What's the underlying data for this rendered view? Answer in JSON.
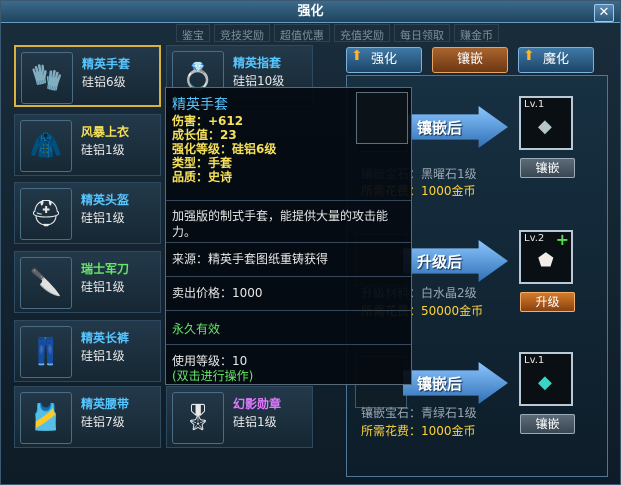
{
  "window": {
    "title": "强化",
    "close": "✕"
  },
  "topnav": [
    "鉴宝",
    "竞技奖励",
    "超值优惠",
    "充值奖励",
    "每日领取",
    "赚金币"
  ],
  "items": [
    {
      "name": "精英手套",
      "sub": "硅铝6级",
      "icon": "🧤",
      "color": "blue",
      "selected": true
    },
    {
      "name": "精英指套",
      "sub": "硅铝10级",
      "icon": "💍",
      "color": "blue",
      "selected": false
    },
    {
      "name": "风暴上衣",
      "sub": "硅铝1级",
      "icon": "🧥",
      "color": "yellow",
      "selected": false
    },
    {
      "name": "精英头盔",
      "sub": "硅铝1级",
      "icon": "⛑",
      "color": "blue",
      "selected": false
    },
    {
      "name": "瑞士军刀",
      "sub": "硅铝1级",
      "icon": "🔪",
      "color": "green",
      "selected": false
    },
    {
      "name": "精英长裤",
      "sub": "硅铝1级",
      "icon": "👖",
      "color": "blue",
      "selected": false
    },
    {
      "name": "精英腰带",
      "sub": "硅铝7级",
      "icon": "🎽",
      "color": "blue",
      "selected": false
    },
    {
      "name": "幻影勋章",
      "sub": "硅铝1级",
      "icon": "🎖",
      "color": "purple",
      "selected": false
    }
  ],
  "tabs": [
    {
      "label": "强化",
      "active": false,
      "arrow": "⬆"
    },
    {
      "label": "镶嵌",
      "active": true,
      "arrow": ""
    },
    {
      "label": "魔化",
      "active": false,
      "arrow": "⬆"
    }
  ],
  "panel": {
    "rows": [
      {
        "arrow_label": "镶嵌后",
        "lv": "Lv.1",
        "gem_icon": "◆",
        "gem_color": "#b8c4cc",
        "button": "镶嵌",
        "button_style": "gray",
        "line1": "镶嵌宝石：黑曜石1级",
        "line2": "所需花费：1000金币",
        "plus": ""
      },
      {
        "arrow_label": "升级后",
        "lv": "Lv.2",
        "gem_icon": "⬟",
        "gem_color": "#f0eee6",
        "button": "升级",
        "button_style": "orange",
        "line1": "升级材料：白水晶2级",
        "line2": "所需花费：50000金币",
        "plus": "+"
      },
      {
        "arrow_label": "镶嵌后",
        "lv": "Lv.1",
        "gem_icon": "◆",
        "gem_color": "#3ad4c4",
        "button": "镶嵌",
        "button_style": "gray",
        "line1": "镶嵌宝石：青绿石1级",
        "line2": "所需花费：1000金币",
        "plus": ""
      }
    ]
  },
  "tooltip": {
    "title": "精英手套",
    "stats": [
      "伤害：+612",
      "成长值：23",
      "强化等级：硅铝6级",
      "类型：手套",
      "品质：史诗"
    ],
    "description": "加强版的制式手套，能提供大量的攻击能力。",
    "source": "来源：精英手套图纸重铸获得",
    "price": "卖出价格：1000",
    "duration": "永久有效",
    "use_level": "使用等级：10",
    "hint": "(双击进行操作)"
  }
}
